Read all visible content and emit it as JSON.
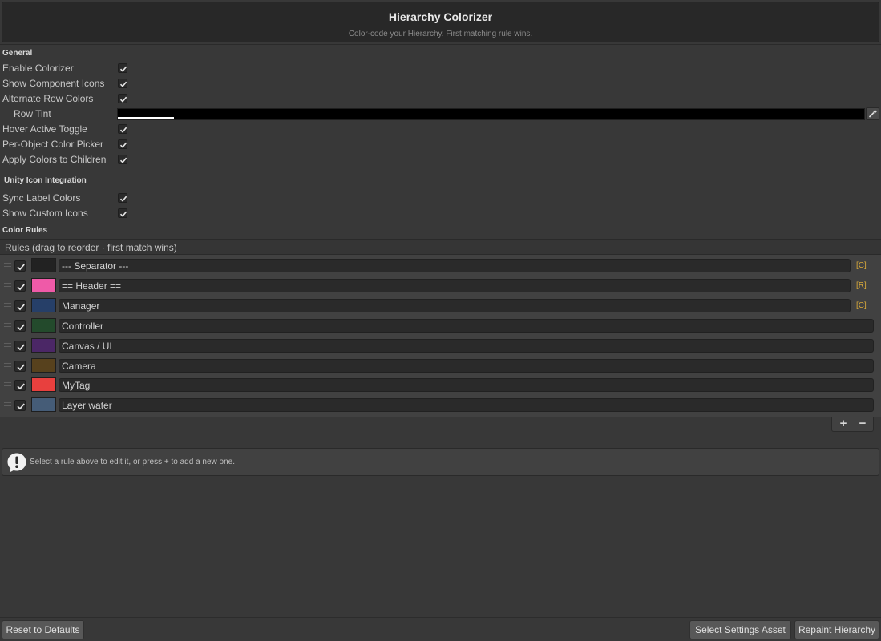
{
  "header": {
    "title": "Hierarchy Colorizer",
    "subtitle": "Color-code your Hierarchy. First matching rule wins."
  },
  "general": {
    "section_label": "General",
    "enable_colorizer": {
      "label": "Enable Colorizer",
      "checked": true
    },
    "show_component_icons": {
      "label": "Show Component Icons",
      "checked": true
    },
    "alternate_row_colors": {
      "label": "Alternate Row Colors",
      "checked": true
    },
    "row_tint": {
      "label": "Row Tint",
      "color": "#000000"
    },
    "hover_active_toggle": {
      "label": "Hover Active Toggle",
      "checked": true
    },
    "per_object_color_picker": {
      "label": "Per-Object Color Picker",
      "checked": true
    },
    "apply_colors_to_children": {
      "label": "Apply Colors to Children",
      "checked": true
    }
  },
  "unity_icons": {
    "section_label": "Unity Icon Integration",
    "sync_label_colors": {
      "label": "Sync Label Colors",
      "checked": true
    },
    "show_custom_icons": {
      "label": "Show Custom Icons",
      "checked": true
    }
  },
  "color_rules": {
    "section_label": "Color Rules",
    "list_header": "Rules  (drag to reorder · first match wins)",
    "rules": [
      {
        "enabled": true,
        "color": "#222222",
        "name": "--- Separator ---",
        "badge": "[C]"
      },
      {
        "enabled": true,
        "color": "#ef5aa8",
        "name": "== Header ==",
        "badge": "[R]"
      },
      {
        "enabled": true,
        "color": "#263f68",
        "name": "Manager",
        "badge": "[C]"
      },
      {
        "enabled": true,
        "color": "#234a2c",
        "name": "Controller",
        "badge": ""
      },
      {
        "enabled": true,
        "color": "#4b2766",
        "name": "Canvas / UI",
        "badge": ""
      },
      {
        "enabled": true,
        "color": "#57411d",
        "name": "Camera",
        "badge": ""
      },
      {
        "enabled": true,
        "color": "#e8403e",
        "name": "MyTag",
        "badge": ""
      },
      {
        "enabled": true,
        "color": "#455c77",
        "name": "Layer water",
        "badge": ""
      }
    ],
    "add_label": "+",
    "remove_label": "−"
  },
  "help": {
    "text": "Select a rule above to edit it, or press  +  to add a new one."
  },
  "footer": {
    "reset_label": "Reset to Defaults",
    "select_asset_label": "Select Settings Asset",
    "repaint_label": "Repaint Hierarchy"
  }
}
